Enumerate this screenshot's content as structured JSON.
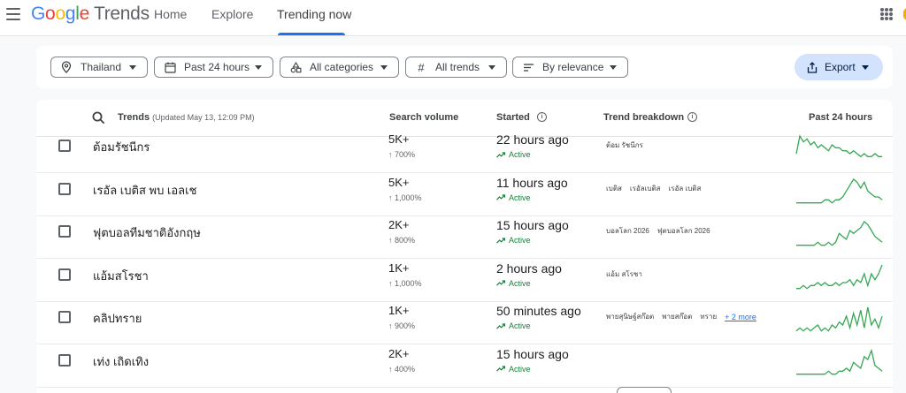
{
  "header": {
    "logo_google": [
      "G",
      "o",
      "o",
      "g",
      "l",
      "e"
    ],
    "logo_suffix": "Trends",
    "tabs": [
      {
        "label": "Home",
        "active": false
      },
      {
        "label": "Explore",
        "active": false
      },
      {
        "label": "Trending now",
        "active": true
      }
    ]
  },
  "filters": {
    "location": "Thailand",
    "time_range": "Past 24 hours",
    "category": "All categories",
    "trend_type": "All trends",
    "sort": "By relevance",
    "export_label": "Export"
  },
  "table": {
    "columns": {
      "trends": "Trends",
      "updated": "(Updated May 13, 12:09 PM)",
      "volume": "Search volume",
      "started": "Started",
      "breakdown": "Trend breakdown",
      "chart": "Past 24 hours"
    },
    "rows": [
      {
        "title": "ต้อมรัชนีกร",
        "volume": "5K+",
        "growth": "700%",
        "started": "22 hours ago",
        "status": "Active",
        "breakdown": [
          "ต้อม รัชนีกร"
        ],
        "more": "",
        "trend": [
          3,
          9,
          7,
          8,
          6,
          7,
          5,
          6,
          5,
          4,
          6,
          5,
          5,
          4,
          4,
          3,
          4,
          3,
          2,
          3,
          2,
          2,
          3,
          2,
          2
        ]
      },
      {
        "title": "เรอัล เบติส พบ เอลเช",
        "volume": "5K+",
        "growth": "1,000%",
        "started": "11 hours ago",
        "status": "Active",
        "breakdown": [
          "เบติส",
          "เรอัลเบติส",
          "เรอัล เบติส"
        ],
        "more": "",
        "trend": [
          1,
          1,
          1,
          1,
          1,
          1,
          1,
          1,
          2,
          2,
          1,
          2,
          2,
          3,
          5,
          7,
          9,
          8,
          6,
          8,
          5,
          4,
          3,
          3,
          2
        ]
      },
      {
        "title": "ฟุตบอลทีมชาติอังกฤษ",
        "volume": "2K+",
        "growth": "800%",
        "started": "15 hours ago",
        "status": "Active",
        "breakdown": [
          "บอลโลก 2026",
          "ฟุตบอลโลก 2026"
        ],
        "more": "",
        "trend": [
          1,
          1,
          1,
          1,
          1,
          1,
          2,
          1,
          1,
          2,
          1,
          2,
          5,
          4,
          3,
          6,
          5,
          6,
          7,
          9,
          8,
          6,
          4,
          3,
          2
        ]
      },
      {
        "title": "แอ้มสโรชา",
        "volume": "1K+",
        "growth": "1,000%",
        "started": "2 hours ago",
        "status": "Active",
        "breakdown": [
          "แอ้ม สโรชา"
        ],
        "more": "",
        "trend": [
          1,
          1,
          2,
          1,
          2,
          2,
          3,
          2,
          3,
          2,
          2,
          3,
          2,
          3,
          3,
          4,
          2,
          4,
          3,
          6,
          2,
          6,
          4,
          6,
          9
        ]
      },
      {
        "title": "คลิปทราย",
        "volume": "1K+",
        "growth": "900%",
        "started": "50 minutes ago",
        "status": "Active",
        "breakdown": [
          "พายสุนิษฐ์สก๊อต",
          "พายสก๊อต",
          "ทราย"
        ],
        "more": "+ 2 more",
        "trend": [
          1,
          2,
          1,
          2,
          1,
          2,
          3,
          1,
          2,
          1,
          3,
          2,
          4,
          3,
          6,
          2,
          7,
          3,
          8,
          2,
          9,
          3,
          5,
          2,
          6
        ]
      },
      {
        "title": "เท่ง เถิดเทิง",
        "volume": "2K+",
        "growth": "400%",
        "started": "15 hours ago",
        "status": "Active",
        "breakdown": [],
        "more": "",
        "trend": [
          1,
          1,
          1,
          1,
          1,
          1,
          1,
          1,
          1,
          2,
          1,
          1,
          2,
          2,
          3,
          2,
          5,
          4,
          3,
          7,
          6,
          9,
          4,
          3,
          2
        ]
      }
    ]
  },
  "colors": {
    "accent": "#1a73e8",
    "active_green": "#188038",
    "spark_green": "#34a853",
    "export_bg": "#d3e3fd"
  }
}
